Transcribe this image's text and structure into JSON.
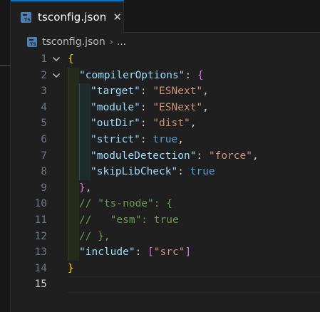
{
  "tab": {
    "label": "tsconfig.json",
    "close_glyph": "✕"
  },
  "breadcrumb": {
    "file": "tsconfig.json",
    "separator": "›",
    "more": "..."
  },
  "editor": {
    "active_line": "15",
    "lines": [
      {
        "n": "1",
        "t1": "{"
      },
      {
        "n": "2",
        "t1": "\"compilerOptions\"",
        "t2": ": ",
        "t3": "{"
      },
      {
        "n": "3",
        "t1": "\"target\"",
        "t2": ": ",
        "t3": "\"ESNext\"",
        "t4": ","
      },
      {
        "n": "4",
        "t1": "\"module\"",
        "t2": ": ",
        "t3": "\"ESNext\"",
        "t4": ","
      },
      {
        "n": "5",
        "t1": "\"outDir\"",
        "t2": ": ",
        "t3": "\"dist\"",
        "t4": ","
      },
      {
        "n": "6",
        "t1": "\"strict\"",
        "t2": ": ",
        "t3": "true",
        "t4": ","
      },
      {
        "n": "7",
        "t1": "\"moduleDetection\"",
        "t2": ": ",
        "t3": "\"force\"",
        "t4": ","
      },
      {
        "n": "8",
        "t1": "\"skipLibCheck\"",
        "t2": ": ",
        "t3": "true"
      },
      {
        "n": "9",
        "t1": "}",
        "t2": ","
      },
      {
        "n": "10",
        "t1": "// \"ts-node\": {"
      },
      {
        "n": "11",
        "t1": "//   \"esm\": true"
      },
      {
        "n": "12",
        "t1": "// },"
      },
      {
        "n": "13",
        "t1": "\"include\"",
        "t2": ": ",
        "t3": "[",
        "t4": "\"src\"",
        "t5": "]"
      },
      {
        "n": "14",
        "t1": "}"
      },
      {
        "n": "15"
      }
    ]
  },
  "colors": {
    "key": "#9cdcfe",
    "string": "#ce9178",
    "boolean": "#569cd6",
    "comment": "#6a9955",
    "bracket1": "#ffd700",
    "bracket2": "#da70d6",
    "bracket3": "#179fff",
    "accent": "#0078d4"
  },
  "icons": {
    "file": "typescript-config-file-icon",
    "fold": "chevron-down-icon"
  }
}
